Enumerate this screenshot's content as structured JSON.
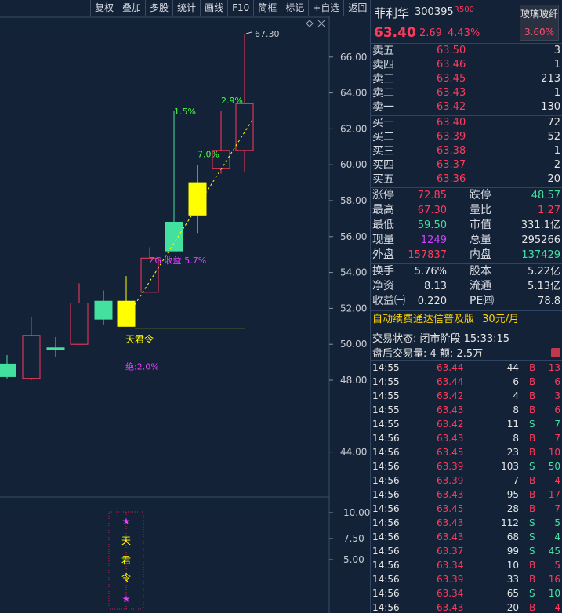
{
  "toolbar": {
    "items": [
      "复权",
      "叠加",
      "多股",
      "统计",
      "画线",
      "F10",
      "简框",
      "标记",
      "+自选",
      "返回"
    ]
  },
  "chart": {
    "price_labels": [
      "66.00",
      "64.00",
      "62.00",
      "60.00",
      "58.00",
      "56.00",
      "54.00",
      "52.00",
      "50.00",
      "48.00",
      "44.00"
    ],
    "price_values": [
      66,
      64,
      62,
      60,
      58,
      56,
      54,
      52,
      50,
      48,
      44
    ],
    "indicator_labels": [
      "10.00",
      "7.50",
      "5.00"
    ],
    "high_label": "67.30",
    "annotations": {
      "pct1": "1.5%",
      "pct2": "2.9%",
      "pct3": "7.0%",
      "zg": "ZG 收益:5.7%",
      "tjl": "天君令",
      "jue": "绝:2.0%"
    },
    "signal_chars": [
      "★",
      "天",
      "君",
      "令",
      "★"
    ],
    "candles": [
      {
        "o": 48.2,
        "c": 48.9,
        "h": 49.4,
        "l": 48.1,
        "kind": "green"
      },
      {
        "o": 48.1,
        "c": 50.5,
        "h": 51.5,
        "l": 48.0,
        "kind": "red"
      },
      {
        "o": 49.8,
        "c": 49.7,
        "h": 50.4,
        "l": 49.3,
        "kind": "green"
      },
      {
        "o": 50.0,
        "c": 52.3,
        "h": 53.4,
        "l": 50.0,
        "kind": "red"
      },
      {
        "o": 52.4,
        "c": 51.4,
        "h": 53.0,
        "l": 51.1,
        "kind": "green"
      },
      {
        "o": 51.0,
        "c": 52.4,
        "h": 53.8,
        "l": 51.0,
        "kind": "yellow"
      },
      {
        "o": 52.9,
        "c": 54.8,
        "h": 55.4,
        "l": 52.9,
        "kind": "red"
      },
      {
        "o": 55.2,
        "c": 56.8,
        "h": 63.0,
        "l": 55.2,
        "kind": "green"
      },
      {
        "o": 57.2,
        "c": 59.0,
        "h": 60.0,
        "l": 56.2,
        "kind": "yellow"
      },
      {
        "o": 59.8,
        "c": 60.8,
        "h": 63.0,
        "l": 59.5,
        "kind": "red"
      },
      {
        "o": 60.8,
        "c": 63.4,
        "h": 67.3,
        "l": 59.6,
        "kind": "red"
      }
    ]
  },
  "quote": {
    "name": "菲利华",
    "code": "300395",
    "tag": "R500",
    "sector_name": "玻璃玻纤",
    "sector_pct": "3.60%",
    "price": "63.40",
    "change": "2.69",
    "change_pct": "4.43%"
  },
  "asks": [
    {
      "label": "卖五",
      "price": "63.50",
      "vol": "3"
    },
    {
      "label": "卖四",
      "price": "63.46",
      "vol": "1"
    },
    {
      "label": "卖三",
      "price": "63.45",
      "vol": "213"
    },
    {
      "label": "卖二",
      "price": "63.43",
      "vol": "1"
    },
    {
      "label": "卖一",
      "price": "63.42",
      "vol": "130"
    }
  ],
  "bids": [
    {
      "label": "买一",
      "price": "63.40",
      "vol": "72"
    },
    {
      "label": "买二",
      "price": "63.39",
      "vol": "52"
    },
    {
      "label": "买三",
      "price": "63.38",
      "vol": "1"
    },
    {
      "label": "买四",
      "price": "63.37",
      "vol": "2"
    },
    {
      "label": "买五",
      "price": "63.36",
      "vol": "20"
    }
  ],
  "stats": [
    {
      "l1": "涨停",
      "v1": "72.85",
      "c1": "#ff3b5c",
      "l2": "跌停",
      "v2": "48.57",
      "c2": "#44e0a0"
    },
    {
      "l1": "最高",
      "v1": "67.30",
      "c1": "#ff3b5c",
      "l2": "量比",
      "v2": "1.27",
      "c2": "#ff3b5c"
    },
    {
      "l1": "最低",
      "v1": "59.50",
      "c1": "#44e0a0",
      "l2": "市值",
      "v2": "331.1亿",
      "c2": "#e6e6e6"
    },
    {
      "l1": "现量",
      "v1": "1249",
      "c1": "#d040ff",
      "l2": "总量",
      "v2": "295266",
      "c2": "#e6e6e6"
    },
    {
      "l1": "外盘",
      "v1": "157837",
      "c1": "#ff3b5c",
      "l2": "内盘",
      "v2": "137429",
      "c2": "#44e0a0"
    }
  ],
  "fund": [
    {
      "l1": "换手",
      "v1": "5.76%",
      "l2": "股本",
      "v2": "5.22亿"
    },
    {
      "l1": "净资",
      "v1": "8.13",
      "l2": "流通",
      "v2": "5.13亿"
    },
    {
      "l1": "收益㈠",
      "v1": "0.220",
      "l2": "PE㈣",
      "v2": "78.8"
    }
  ],
  "promo": {
    "text": "自动续费通达信普及版",
    "price": "30元/月"
  },
  "trade_status": {
    "line1": "交易状态: 闭市阶段 15:33:15",
    "line2": "盘后交易量: 4  额: 2.5万"
  },
  "trades": [
    {
      "t": "14:55",
      "p": "63.44",
      "v": "44",
      "d": "B",
      "n": "13"
    },
    {
      "t": "14:55",
      "p": "63.44",
      "v": "6",
      "d": "B",
      "n": "6"
    },
    {
      "t": "14:55",
      "p": "63.42",
      "v": "4",
      "d": "B",
      "n": "3"
    },
    {
      "t": "14:55",
      "p": "63.43",
      "v": "8",
      "d": "B",
      "n": "6"
    },
    {
      "t": "14:55",
      "p": "63.42",
      "v": "11",
      "d": "S",
      "n": "7"
    },
    {
      "t": "14:56",
      "p": "63.43",
      "v": "8",
      "d": "B",
      "n": "7"
    },
    {
      "t": "14:56",
      "p": "63.45",
      "v": "23",
      "d": "B",
      "n": "10"
    },
    {
      "t": "14:56",
      "p": "63.39",
      "v": "103",
      "d": "S",
      "n": "50"
    },
    {
      "t": "14:56",
      "p": "63.39",
      "v": "7",
      "d": "B",
      "n": "4"
    },
    {
      "t": "14:56",
      "p": "63.43",
      "v": "95",
      "d": "B",
      "n": "17"
    },
    {
      "t": "14:56",
      "p": "63.45",
      "v": "28",
      "d": "B",
      "n": "7"
    },
    {
      "t": "14:56",
      "p": "63.43",
      "v": "112",
      "d": "S",
      "n": "5"
    },
    {
      "t": "14:56",
      "p": "63.43",
      "v": "68",
      "d": "S",
      "n": "4"
    },
    {
      "t": "14:56",
      "p": "63.37",
      "v": "99",
      "d": "S",
      "n": "45"
    },
    {
      "t": "14:56",
      "p": "63.34",
      "v": "10",
      "d": "B",
      "n": "5"
    },
    {
      "t": "14:56",
      "p": "63.39",
      "v": "33",
      "d": "B",
      "n": "16"
    },
    {
      "t": "14:56",
      "p": "63.34",
      "v": "65",
      "d": "S",
      "n": "10"
    },
    {
      "t": "14:56",
      "p": "63.43",
      "v": "20",
      "d": "B",
      "n": "4"
    }
  ],
  "colors": {
    "background": "#132237",
    "up": "#ff3b5c",
    "down": "#44e0a0",
    "signal_yellow": "#ffff00",
    "magenta": "#e040ff"
  }
}
